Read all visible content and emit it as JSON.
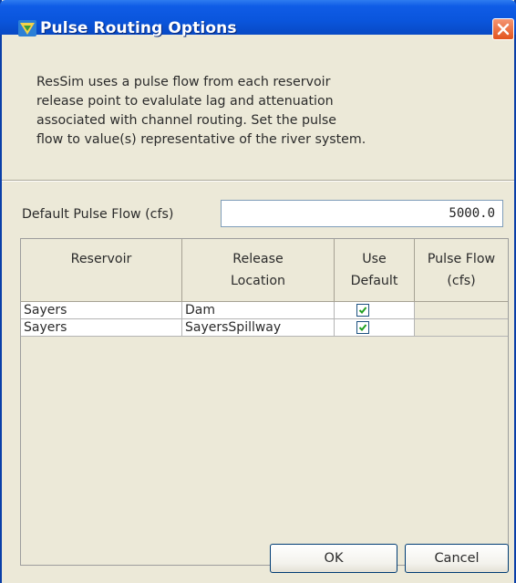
{
  "window": {
    "title": "Pulse Routing Options",
    "accent_color": "#0a55dc",
    "close_color": "#e3531d"
  },
  "description": {
    "lines": [
      "ResSim uses a pulse flow from each reservoir",
      "release point to evalulate lag and attenuation",
      "associated with channel routing.  Set the pulse",
      "flow to value(s)  representative of the river system."
    ]
  },
  "default_pulse": {
    "label": "Default Pulse Flow (cfs)",
    "value": "5000.0"
  },
  "table": {
    "columns": [
      [
        "Reservoir"
      ],
      [
        "Release",
        "Location"
      ],
      [
        "Use",
        "Default"
      ],
      [
        "Pulse Flow",
        "(cfs)"
      ]
    ],
    "rows": [
      {
        "reservoir": "Sayers",
        "release_location": "Dam",
        "use_default": true,
        "pulse_flow": ""
      },
      {
        "reservoir": "Sayers",
        "release_location": "SayersSpillway",
        "use_default": true,
        "pulse_flow": ""
      }
    ]
  },
  "buttons": {
    "ok": "OK",
    "cancel": "Cancel"
  },
  "icons": {
    "title": "resSim-app-icon",
    "close": "close-icon",
    "check": "checkmark-icon"
  }
}
